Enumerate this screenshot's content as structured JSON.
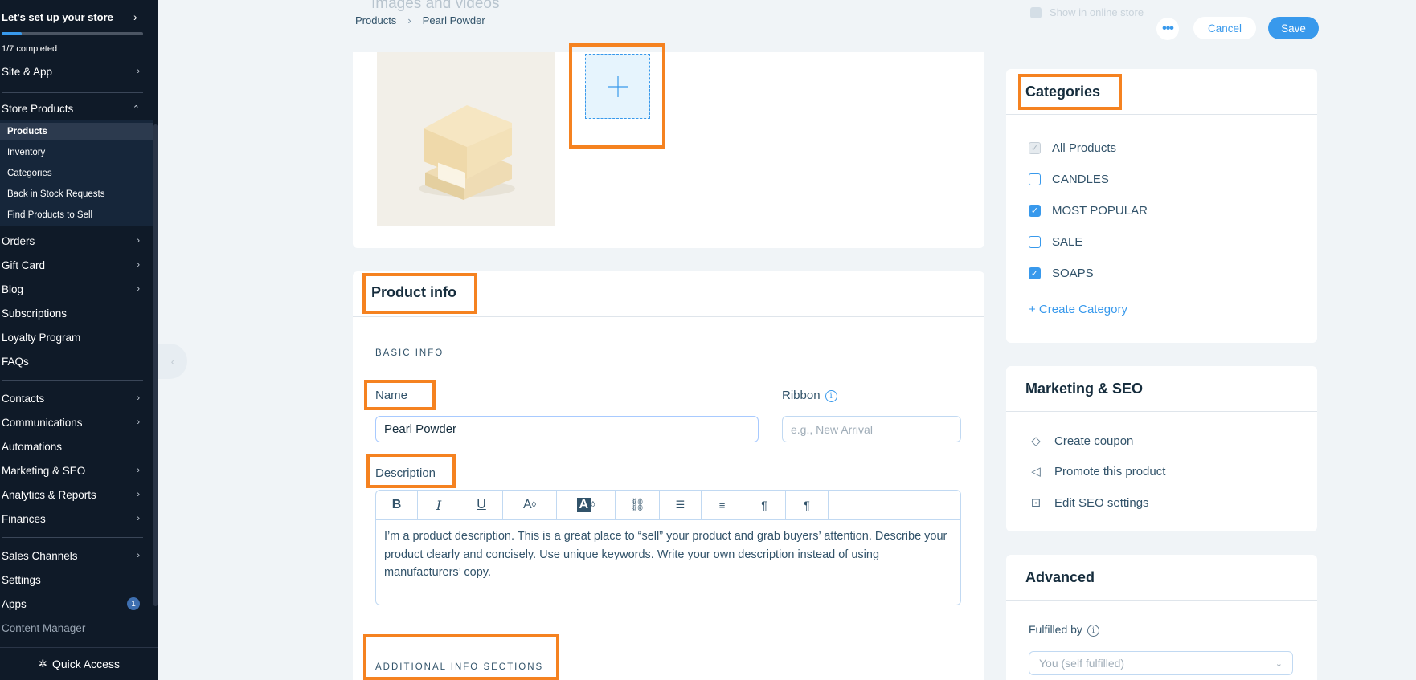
{
  "sidebar": {
    "setup_title": "Let's set up your store",
    "setup_progress": 0.14,
    "setup_count": "1/7 completed",
    "items": [
      {
        "label": "Site & App"
      },
      {
        "label": "Store Products"
      },
      {
        "label": "Orders"
      },
      {
        "label": "Gift Card"
      },
      {
        "label": "Blog"
      },
      {
        "label": "Subscriptions"
      },
      {
        "label": "Loyalty Program"
      },
      {
        "label": "FAQs"
      },
      {
        "label": "Contacts"
      },
      {
        "label": "Communications"
      },
      {
        "label": "Automations"
      },
      {
        "label": "Marketing & SEO"
      },
      {
        "label": "Analytics & Reports"
      },
      {
        "label": "Finances"
      },
      {
        "label": "Sales Channels"
      },
      {
        "label": "Settings"
      },
      {
        "label": "Apps",
        "badge": "1"
      },
      {
        "label": "Content Manager"
      }
    ],
    "sub_items": [
      {
        "label": "Products"
      },
      {
        "label": "Inventory"
      },
      {
        "label": "Categories"
      },
      {
        "label": "Back in Stock Requests"
      },
      {
        "label": "Find Products to Sell"
      }
    ],
    "quick_access": "Quick Access"
  },
  "header": {
    "breadcrumb": [
      "Products",
      "Pearl Powder"
    ],
    "ghost_title": "Images and videos",
    "ghost_checkbox": "Show in online store",
    "cancel_label": "Cancel",
    "save_label": "Save"
  },
  "product_info": {
    "title": "Product info",
    "section_basic": "BASIC INFO",
    "name_label": "Name",
    "name_value": "Pearl Powder",
    "ribbon_label": "Ribbon",
    "ribbon_placeholder": "e.g., New Arrival",
    "description_label": "Description",
    "description_text": "I’m a product description. This is a great place to “sell” your product and grab buyers’ attention. Describe your product clearly and concisely. Use unique keywords. Write your own description instead of using manufacturers’ copy.",
    "section_additional": "ADDITIONAL INFO SECTIONS"
  },
  "categories": {
    "title": "Categories",
    "items": [
      {
        "label": "All Products",
        "checked": true,
        "disabled": true
      },
      {
        "label": "CANDLES",
        "checked": false
      },
      {
        "label": "MOST POPULAR",
        "checked": true
      },
      {
        "label": "SALE",
        "checked": false
      },
      {
        "label": "SOAPS",
        "checked": true
      }
    ],
    "create_label": "+ Create Category"
  },
  "marketing": {
    "title": "Marketing & SEO",
    "items": [
      {
        "label": "Create coupon",
        "icon": "coupon-icon"
      },
      {
        "label": "Promote this product",
        "icon": "megaphone-icon"
      },
      {
        "label": "Edit SEO settings",
        "icon": "seo-icon"
      }
    ]
  },
  "advanced": {
    "title": "Advanced",
    "fulfilled_label": "Fulfilled by",
    "fulfilled_value": "You (self fulfilled)"
  },
  "colors": {
    "accent": "#3899ec",
    "highlight": "#f58220",
    "sidebar_bg": "#0f1a28"
  }
}
